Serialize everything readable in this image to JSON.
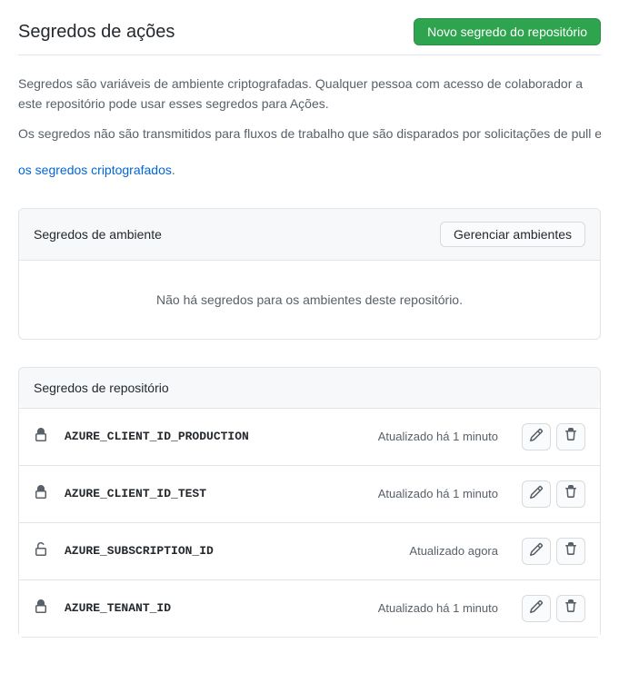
{
  "header": {
    "title": "Segredos de ações",
    "new_secret_button": "Novo segredo do repositório"
  },
  "description": {
    "line1": "Segredos são variáveis de ambiente criptografadas. Qualquer pessoa com acesso de colaborador a este repositório pode usar esses segredos para Ações.",
    "line2": "Os segredos não são transmitidos para fluxos de trabalho que são disparados por solicitações de pull em um ",
    "link": "os segredos criptografados"
  },
  "env_panel": {
    "title": "Segredos de ambiente",
    "manage_button": "Gerenciar ambientes",
    "empty_message": "Não há segredos para os ambientes deste repositório."
  },
  "repo_panel": {
    "title": "Segredos de repositório",
    "secrets": [
      {
        "name": "AZURE_CLIENT_ID_PRODUCTION",
        "updated": "Atualizado há 1 minuto",
        "unlocked": false
      },
      {
        "name": "AZURE_CLIENT_ID_TEST",
        "updated": "Atualizado há 1 minuto",
        "unlocked": false
      },
      {
        "name": "AZURE_SUBSCRIPTION_ID",
        "updated": "Atualizado agora",
        "unlocked": true
      },
      {
        "name": "AZURE_TENANT_ID",
        "updated": "Atualizado há 1 minuto",
        "unlocked": false
      }
    ]
  }
}
